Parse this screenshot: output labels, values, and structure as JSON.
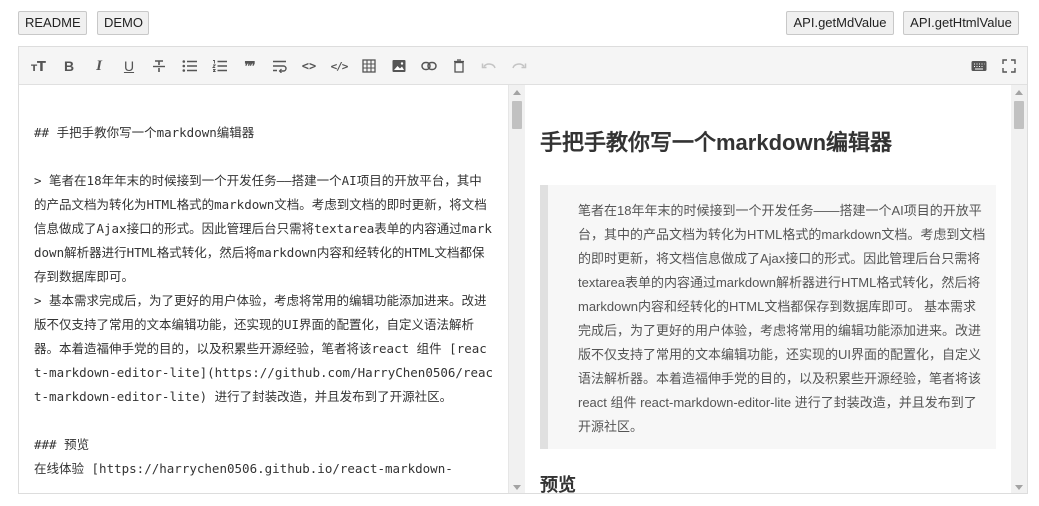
{
  "topbar": {
    "readme_label": "README",
    "demo_label": "DEMO",
    "get_md_label": "API.getMdValue",
    "get_html_label": "API.getHtmlValue"
  },
  "toolbar": {
    "icons": [
      "header-icon",
      "bold-icon",
      "italic-icon",
      "underline-icon",
      "strikethrough-icon",
      "unordered-list-icon",
      "ordered-list-icon",
      "quote-icon",
      "wrap-icon",
      "inline-code-icon",
      "code-block-icon",
      "table-icon",
      "image-icon",
      "link-icon",
      "clear-icon",
      "undo-icon",
      "redo-icon",
      "keyboard-icon",
      "fullscreen-icon"
    ],
    "bold_glyph": "B",
    "italic_glyph": "I",
    "underline_glyph": "U",
    "quote_glyph": "❞❞",
    "inline_code_glyph": "<>",
    "code_block_glyph": "</>"
  },
  "editor": {
    "markdown": "## 手把手教你写一个markdown编辑器\n\n> 笔者在18年年末的时候接到一个开发任务——搭建一个AI项目的开放平台，其中的产品文档为转化为HTML格式的markdown文档。考虑到文档的即时更新，将文档信息做成了Ajax接口的形式。因此管理后台只需将textarea表单的内容通过markdown解析器进行HTML格式转化，然后将markdown内容和经转化的HTML文档都保存到数据库即可。\n> 基本需求完成后，为了更好的用户体验，考虑将常用的编辑功能添加进来。改进版不仅支持了常用的文本编辑功能，还实现的UI界面的配置化，自定义语法解析器。本着造福伸手党的目的，以及积累些开源经验，笔者将该react 组件 [react-markdown-editor-lite](https://github.com/HarryChen0506/react-markdown-editor-lite) 进行了封装改造，并且发布到了开源社区。\n\n### 预览\n在线体验 [https://harrychen0506.github.io/react-markdown-"
  },
  "preview": {
    "title": "手把手教你写一个markdown编辑器",
    "quote": "笔者在18年年末的时候接到一个开发任务——搭建一个AI项目的开放平台，其中的产品文档为转化为HTML格式的markdown文档。考虑到文档的即时更新，将文档信息做成了Ajax接口的形式。因此管理后台只需将textarea表单的内容通过markdown解析器进行HTML格式转化，然后将markdown内容和经转化的HTML文档都保存到数据库即可。 基本需求完成后，为了更好的用户体验，考虑将常用的编辑功能添加进来。改进版不仅支持了常用的文本编辑功能，还实现的UI界面的配置化，自定义语法解析器。本着造福伸手党的目的，以及积累些开源经验，笔者将该react 组件 react-markdown-editor-lite 进行了封装改造，并且发布到了开源社区。",
    "subtitle": "预览"
  }
}
